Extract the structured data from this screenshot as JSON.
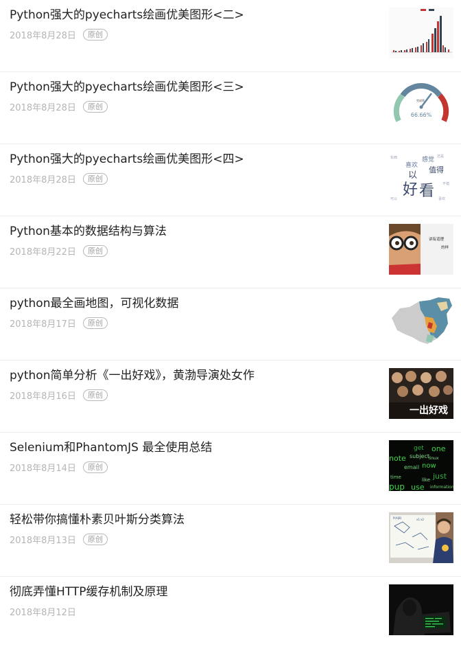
{
  "articles": [
    {
      "title": "Python强大的pyecharts绘画优美图形<二>",
      "date": "2018年8月28日",
      "badge": "原创",
      "thumb": "bar-chart-thumbnail"
    },
    {
      "title": "Python强大的pyecharts绘画优美图形<三>",
      "date": "2018年8月28日",
      "badge": "原创",
      "thumb": "gauge-thumbnail",
      "thumb_text": "66.66%"
    },
    {
      "title": "Python强大的pyecharts绘画优美图形<四>",
      "date": "2018年8月28日",
      "badge": "原创",
      "thumb": "wordcloud-thumbnail",
      "thumb_words": [
        "好",
        "看",
        "以",
        "值得",
        "喜欢",
        "感觉"
      ]
    },
    {
      "title": "Python基本的数据结构与算法",
      "date": "2018年8月22日",
      "badge": "原创",
      "thumb": "child-glasses-thumbnail",
      "thumb_words": [
        "讲有道理",
        "的样"
      ]
    },
    {
      "title": "python最全画地图，可视化数据",
      "date": "2018年8月17日",
      "badge": "原创",
      "thumb": "china-map-thumbnail"
    },
    {
      "title": "python简单分析《一出好戏》，黄渤导演处女作",
      "date": "2018年8月16日",
      "badge": "原创",
      "thumb": "movie-poster-thumbnail",
      "thumb_words": [
        "一出好戏"
      ]
    },
    {
      "title": "Selenium和PhantomJS 最全使用总结",
      "date": "2018年8月14日",
      "badge": "原创",
      "thumb": "green-wordcloud-thumbnail",
      "thumb_words": [
        "one",
        "get",
        "subject",
        "note",
        "email",
        "now",
        "just",
        "pup",
        "use",
        "like",
        "time",
        "linux",
        "information"
      ]
    },
    {
      "title": "轻松带你搞懂朴素贝叶斯分类算法",
      "date": "2018年8月13日",
      "badge": "原创",
      "thumb": "whiteboard-thumbnail"
    },
    {
      "title": "彻底弄懂HTTP缓存机制及原理",
      "date": "2018年8月12日",
      "badge": "",
      "thumb": "hacker-laptop-thumbnail"
    }
  ],
  "colors": {
    "title": "#222222",
    "date": "#b5b5b5",
    "badge": "#a0a0a0",
    "divider": "#eeeeee"
  }
}
